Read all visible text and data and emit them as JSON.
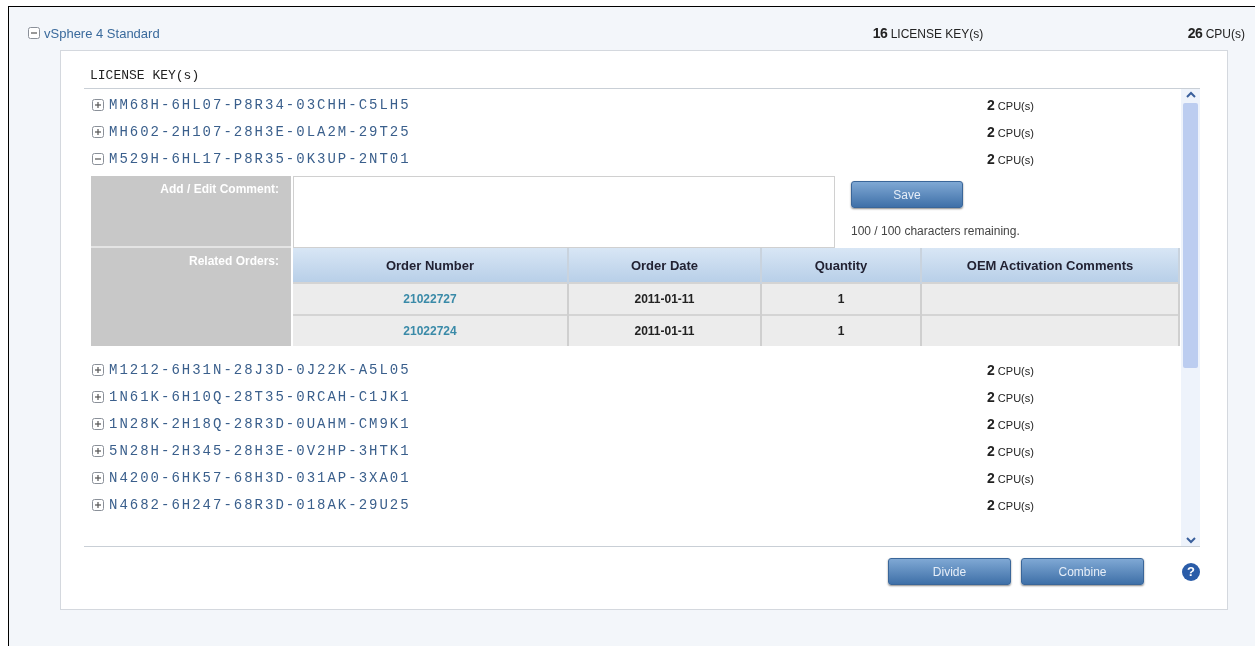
{
  "product": {
    "title": "vSphere 4 Standard",
    "expanded": true,
    "license_count": "16",
    "license_unit": "LICENSE KEY(s)",
    "cpu_count": "26",
    "cpu_unit": "CPU(s)"
  },
  "license_list": {
    "heading": "LICENSE KEY(s)",
    "keys": [
      {
        "key": "MM68H-6HL07-P8R34-03CHH-C5LH5",
        "cpu_count": "2",
        "cpu_unit": "CPU(s)",
        "expanded": false
      },
      {
        "key": "MH602-2H107-28H3E-0LA2M-29T25",
        "cpu_count": "2",
        "cpu_unit": "CPU(s)",
        "expanded": false
      },
      {
        "key": "M529H-6HL17-P8R35-0K3UP-2NT01",
        "cpu_count": "2",
        "cpu_unit": "CPU(s)",
        "expanded": true,
        "details": {
          "comment_label": "Add / Edit Comment:",
          "save_button": "Save",
          "remaining": "100 / 100 characters remaining.",
          "orders_label": "Related Orders:",
          "columns": [
            "Order Number",
            "Order Date",
            "Quantity",
            "OEM Activation Comments"
          ],
          "rows": [
            {
              "order_number": "21022727",
              "order_date": "2011-01-11",
              "quantity": "1"
            },
            {
              "order_number": "21022724",
              "order_date": "2011-01-11",
              "quantity": "1"
            }
          ]
        }
      },
      {
        "key": "M1212-6H31N-28J3D-0J22K-A5L05",
        "cpu_count": "2",
        "cpu_unit": "CPU(s)",
        "expanded": false
      },
      {
        "key": "1N61K-6H10Q-28T35-0RCAH-C1JK1",
        "cpu_count": "2",
        "cpu_unit": "CPU(s)",
        "expanded": false
      },
      {
        "key": "1N28K-2H18Q-28R3D-0UAHM-CM9K1",
        "cpu_count": "2",
        "cpu_unit": "CPU(s)",
        "expanded": false
      },
      {
        "key": "5N28H-2H345-28H3E-0V2HP-3HTK1",
        "cpu_count": "2",
        "cpu_unit": "CPU(s)",
        "expanded": false
      },
      {
        "key": "N4200-6HK57-68H3D-031AP-3XA01",
        "cpu_count": "2",
        "cpu_unit": "CPU(s)",
        "expanded": false
      },
      {
        "key": "N4682-6H247-68R3D-018AK-29U25",
        "cpu_count": "2",
        "cpu_unit": "CPU(s)",
        "expanded": false
      }
    ]
  },
  "buttons": [
    "Divide",
    "Combine"
  ],
  "help": "?"
}
